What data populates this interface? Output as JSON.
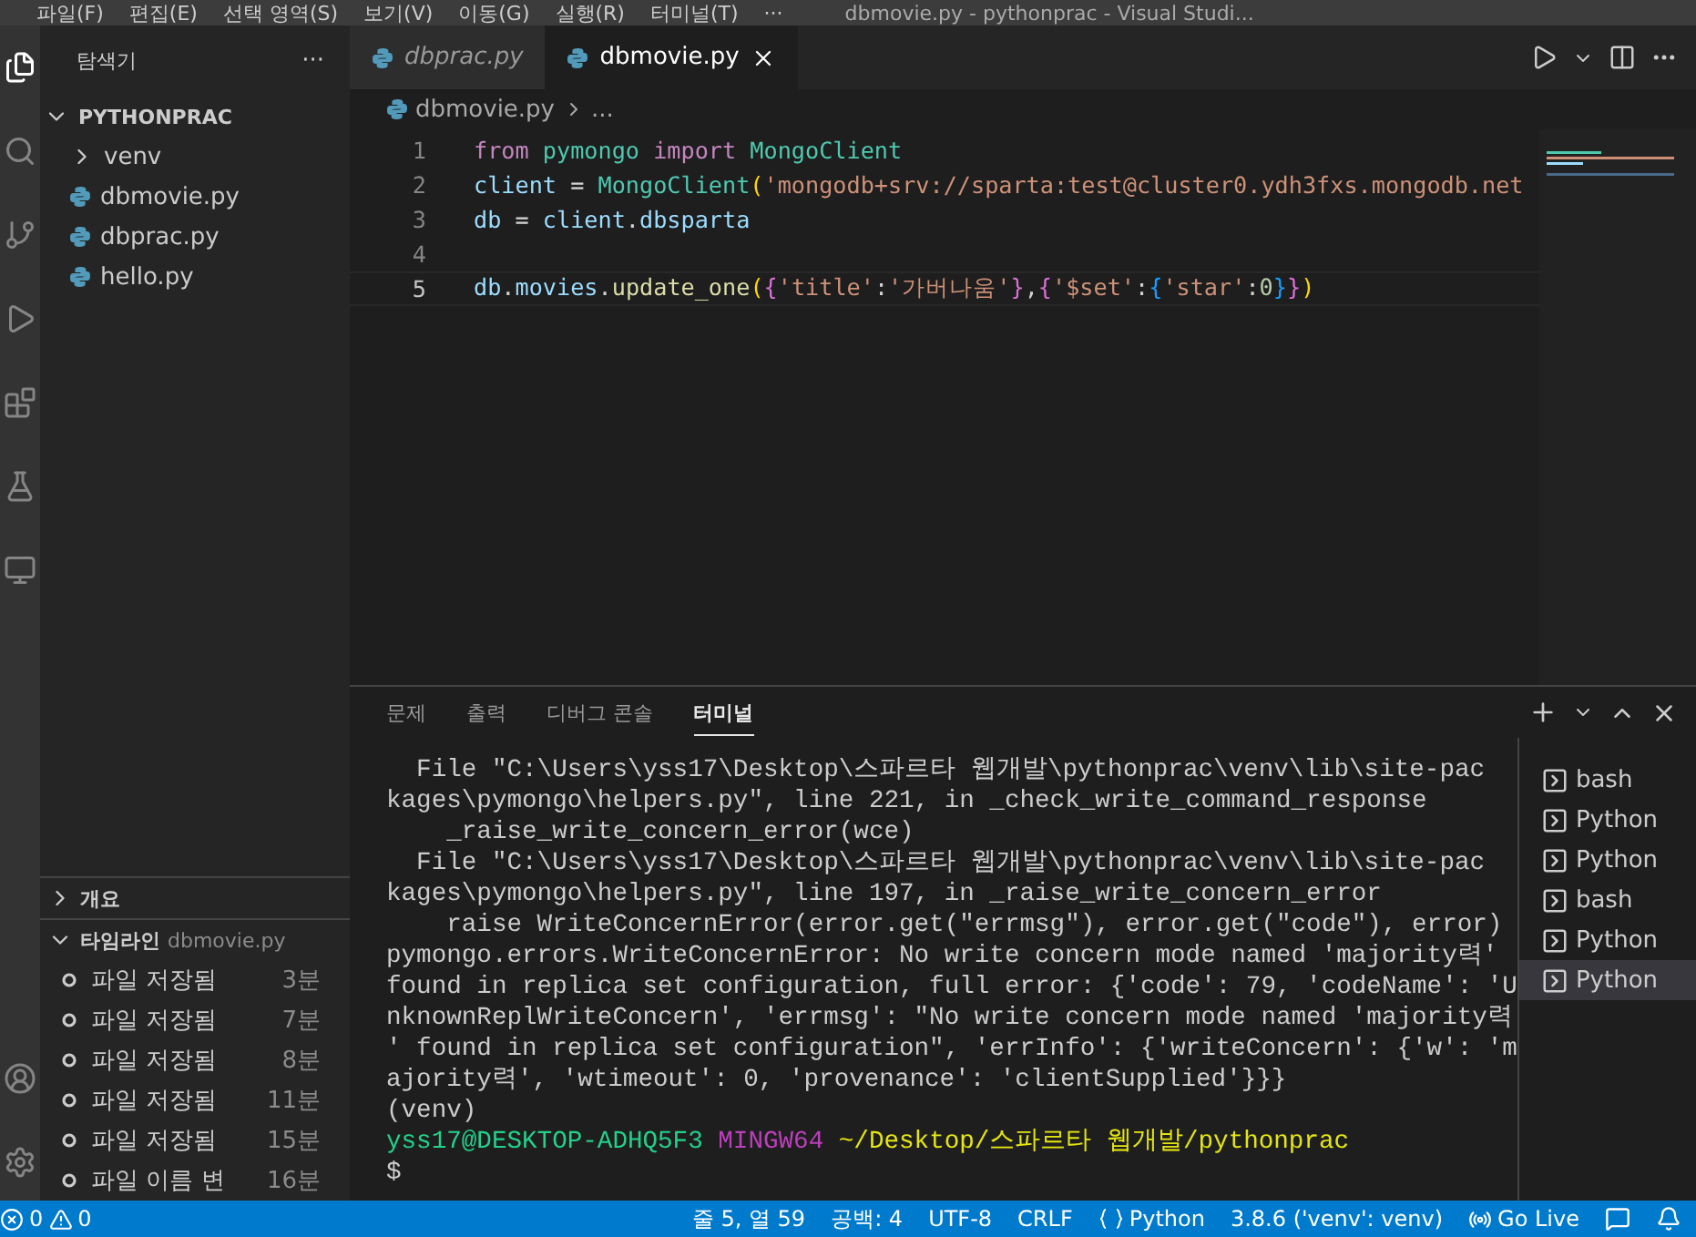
{
  "title_bar": {
    "menus": [
      "파일(F)",
      "편집(E)",
      "선택 영역(S)",
      "보기(V)",
      "이동(G)",
      "실행(R)",
      "터미널(T)",
      "···"
    ],
    "title": "dbmovie.py - pythonprac - Visual Studi..."
  },
  "sidebar": {
    "title": "탐색기",
    "more": "···",
    "folder": {
      "name": "PYTHONPRAC",
      "expanded": true
    },
    "items": [
      {
        "name": "venv",
        "kind": "folder",
        "expanded": false
      },
      {
        "name": "dbmovie.py",
        "kind": "python"
      },
      {
        "name": "dbprac.py",
        "kind": "python"
      },
      {
        "name": "hello.py",
        "kind": "python"
      }
    ],
    "outline": {
      "name": "개요",
      "expanded": false
    },
    "timeline": {
      "name": "타임라인",
      "file": "dbmovie.py",
      "expanded": true,
      "items": [
        {
          "label": "파일 저장됨",
          "time": "3분"
        },
        {
          "label": "파일 저장됨",
          "time": "7분"
        },
        {
          "label": "파일 저장됨",
          "time": "8분"
        },
        {
          "label": "파일 저장됨",
          "time": "11분"
        },
        {
          "label": "파일 저장됨",
          "time": "15분"
        },
        {
          "label": "파일 이름 변",
          "time": "16분"
        }
      ]
    }
  },
  "editor": {
    "tabs": [
      {
        "label": "dbprac.py",
        "selected": false,
        "preview": true
      },
      {
        "label": "dbmovie.py",
        "selected": true,
        "preview": false
      }
    ],
    "breadcrumb": [
      "dbmovie.py",
      "..."
    ],
    "lines": [
      {
        "number": "1",
        "current": false,
        "tokens": [
          {
            "text": "from",
            "kind": "keyword"
          },
          {
            "text": " pymongo",
            "kind": "class"
          },
          {
            "text": " import",
            "kind": "keyword"
          },
          {
            "text": " MongoClient",
            "kind": "class"
          }
        ]
      },
      {
        "number": "2",
        "current": false,
        "tokens": [
          {
            "text": "client",
            "kind": "var"
          },
          {
            "text": " = ",
            "kind": "plain"
          },
          {
            "text": "MongoClient",
            "kind": "class"
          },
          {
            "text": "(",
            "kind": "bracket1"
          },
          {
            "text": "'mongodb+srv://sparta:test@cluster0.ydh3fxs.mongodb.net",
            "kind": "string"
          }
        ]
      },
      {
        "number": "3",
        "current": false,
        "tokens": [
          {
            "text": "db",
            "kind": "var"
          },
          {
            "text": " = ",
            "kind": "plain"
          },
          {
            "text": "client",
            "kind": "var"
          },
          {
            "text": ".",
            "kind": "plain"
          },
          {
            "text": "dbsparta",
            "kind": "var"
          }
        ]
      },
      {
        "number": "4",
        "current": false
      },
      {
        "number": "5",
        "current": true,
        "tokens": [
          {
            "text": "db",
            "kind": "var"
          },
          {
            "text": ".",
            "kind": "plain"
          },
          {
            "text": "movies",
            "kind": "var"
          },
          {
            "text": ".",
            "kind": "plain"
          },
          {
            "text": "update_one",
            "kind": "func"
          },
          {
            "text": "(",
            "kind": "bracket1"
          },
          {
            "text": "{",
            "kind": "bracket2"
          },
          {
            "text": "'title'",
            "kind": "string"
          },
          {
            "text": ":",
            "kind": "plain"
          },
          {
            "text": "'가버나움'",
            "kind": "string"
          },
          {
            "text": "}",
            "kind": "bracket2"
          },
          {
            "text": ",",
            "kind": "plain"
          },
          {
            "text": "{",
            "kind": "bracket2"
          },
          {
            "text": "'$set'",
            "kind": "string"
          },
          {
            "text": ":",
            "kind": "plain"
          },
          {
            "text": "{",
            "kind": "bracket3"
          },
          {
            "text": "'star'",
            "kind": "string"
          },
          {
            "text": ":",
            "kind": "plain"
          },
          {
            "text": "0",
            "kind": "number"
          },
          {
            "text": "}",
            "kind": "bracket3"
          },
          {
            "text": "}",
            "kind": "bracket2"
          },
          {
            "text": ")",
            "kind": "bracket1"
          }
        ]
      }
    ]
  },
  "panel": {
    "tabs": [
      {
        "label": "문제",
        "selected": false
      },
      {
        "label": "출력",
        "selected": false
      },
      {
        "label": "디버그 콘솔",
        "selected": false
      },
      {
        "label": "터미널",
        "selected": true
      }
    ],
    "terminal": [
      {
        "kind": "text",
        "text": "  File \"C:\\Users\\yss17\\Desktop\\스파르타 웹개발\\pythonprac\\venv\\lib\\site-pac"
      },
      {
        "kind": "text",
        "text": "kages\\pymongo\\helpers.py\", line 221, in _check_write_command_response"
      },
      {
        "kind": "text",
        "text": "    _raise_write_concern_error(wce)"
      },
      {
        "kind": "text",
        "text": "  File \"C:\\Users\\yss17\\Desktop\\스파르타 웹개발\\pythonprac\\venv\\lib\\site-pac"
      },
      {
        "kind": "text",
        "text": "kages\\pymongo\\helpers.py\", line 197, in _raise_write_concern_error"
      },
      {
        "kind": "text",
        "text": "    raise WriteConcernError(error.get(\"errmsg\"), error.get(\"code\"), error)"
      },
      {
        "kind": "text",
        "text": "pymongo.errors.WriteConcernError: No write concern mode named 'majority력'"
      },
      {
        "kind": "text",
        "text": "found in replica set configuration, full error: {'code': 79, 'codeName': 'U"
      },
      {
        "kind": "text",
        "text": "nknownReplWriteConcern', 'errmsg': \"No write concern mode named 'majority력"
      },
      {
        "kind": "text",
        "text": "' found in replica set configuration\", 'errInfo': {'writeConcern': {'w': 'm"
      },
      {
        "kind": "text",
        "text": "ajority력', 'wtimeout': 0, 'provenance': 'clientSupplied'}}}"
      },
      {
        "kind": "text",
        "text": "(venv)"
      },
      {
        "kind": "prompt",
        "user": "yss17@DESKTOP-ADHQ5F3",
        "shell": "MINGW64",
        "path": "~/Desktop/스파르타 웹개발/pythonprac"
      },
      {
        "kind": "text",
        "text": "$"
      }
    ],
    "sessions": [
      {
        "label": "bash",
        "selected": false
      },
      {
        "label": "Python",
        "selected": false
      },
      {
        "label": "Python",
        "selected": false
      },
      {
        "label": "bash",
        "selected": false
      },
      {
        "label": "Python",
        "selected": false
      },
      {
        "label": "Python",
        "selected": true
      }
    ]
  },
  "status_bar": {
    "errors": "0",
    "warnings": "0",
    "items": [
      "줄 5, 열 59",
      "공백: 4",
      "UTF-8",
      "CRLF"
    ],
    "language": "Python",
    "interpreter": "3.8.6 ('venv': venv)",
    "live": "Go Live"
  }
}
